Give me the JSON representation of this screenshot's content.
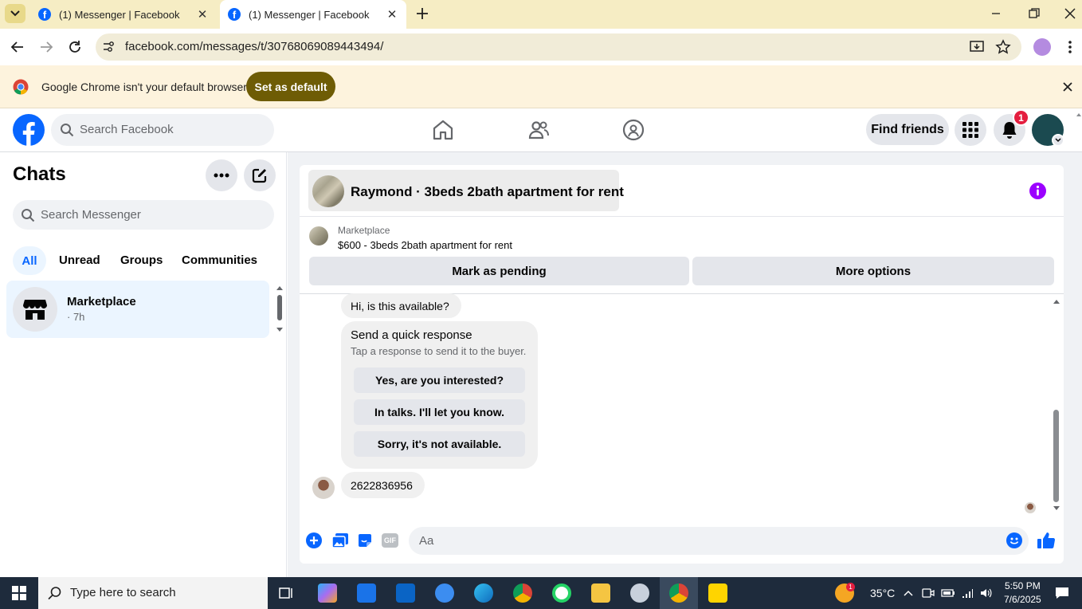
{
  "browser": {
    "tabs": [
      {
        "title": "(1) Messenger | Facebook"
      },
      {
        "title": "(1) Messenger | Facebook"
      }
    ],
    "url": "facebook.com/messages/t/30768069089443494/",
    "infobar": {
      "message": "Google Chrome isn't your default browser",
      "button": "Set as default"
    }
  },
  "facebook": {
    "search_placeholder": "Search Facebook",
    "find_friends": "Find friends",
    "notification_count": "1"
  },
  "chats": {
    "title": "Chats",
    "search_placeholder": "Search Messenger",
    "filters": [
      "All",
      "Unread",
      "Groups",
      "Communities"
    ],
    "active_filter": "All",
    "items": [
      {
        "name": "Marketplace",
        "time": "· 7h"
      }
    ]
  },
  "conversation": {
    "title": "Raymond · 3beds 2bath apartment for rent",
    "listing": {
      "source": "Marketplace",
      "summary": "$600 - 3beds 2bath apartment for rent"
    },
    "actions": {
      "mark_pending": "Mark as pending",
      "more_options": "More options"
    },
    "messages": [
      {
        "text": "Hi, is this available?"
      },
      {
        "text": "2622836956"
      }
    ],
    "quick_response": {
      "title": "Send a quick response",
      "subtitle": "Tap a response to send it to the buyer.",
      "options": [
        "Yes, are you interested?",
        "In talks. I'll let you know.",
        "Sorry, it's not available."
      ]
    },
    "composer_placeholder": "Aa"
  },
  "taskbar": {
    "search_placeholder": "Type here to search",
    "temperature": "35°C",
    "weather_badge": "1",
    "time": "5:50 PM",
    "date": "7/6/2025"
  },
  "colors": {
    "facebook_blue": "#0866ff",
    "chrome_frame": "#f6edc4",
    "set_default_button": "#6e5c05"
  }
}
